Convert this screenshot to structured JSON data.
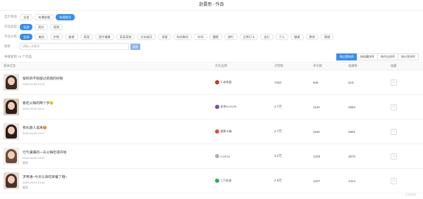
{
  "page_title": "赵露思 - 作品",
  "filters": {
    "row1": {
      "label": "显示筛选",
      "chips": [
        "全部",
        "有播放量",
        "有视频号"
      ],
      "active": 2
    },
    "row2": {
      "label": "作品类型",
      "chips": [
        "全部",
        "图文",
        "视频"
      ],
      "active": 0
    },
    "row3": {
      "label": "作品分类",
      "chips": [
        "全部",
        "美妆",
        "护肤",
        "美食",
        "萌宠",
        "医疗健康",
        "家居家装",
        "文化娱乐",
        "母婴",
        "科技数码",
        "时尚",
        "摄影",
        "旅行",
        "日常打卡",
        "出行",
        "个人",
        "健康",
        "教育",
        "情感"
      ],
      "active": 0
    },
    "row4": {
      "label": "搜索",
      "placeholder": "请输入关键词",
      "button": "搜索"
    }
  },
  "result_count": "共搜索到 74 个作品",
  "sort_buttons": [
    "按点赞排序",
    "按收藏排序",
    "按评论排序",
    "按分享排序"
  ],
  "sort_active": 0,
  "columns": [
    "基本信息",
    "合作品牌",
    "点赞数",
    "评论数",
    "收藏数",
    "收藏"
  ],
  "rows": [
    {
      "title": "留校的不陪留过的我的好啦",
      "date": "2020-10-09 10:21",
      "extra": "",
      "author": "小迪电器",
      "likes": "7250",
      "comments": "945",
      "collects": "619",
      "hair": "#3b2a24",
      "bg": "#e9e3de",
      "aicon": "#c0392b"
    },
    {
      "title": "看吃火锅的两个手🙂",
      "date": "2020-09-30 16:11",
      "extra": "",
      "author": "参考NYSCPL",
      "likes": "2.7万",
      "comments": "1134",
      "collects": "2693",
      "hair": "#2b1e19",
      "bg": "#d8c9b8",
      "aicon": "#7a4ea3"
    },
    {
      "title": "有伙题人选来😡",
      "date": "2020-09-25 19:07",
      "extra": "",
      "author": "健康卡编",
      "likes": "2.7万",
      "comments": "1165",
      "collects": "2861",
      "hair": "#2a1c17",
      "bg": "#eae4e2",
      "aicon": "#e74c3c"
    },
    {
      "title": "元气满满的一天火锅吃得开始",
      "date": "2020-09-08 18:37",
      "extra": "搬家",
      "author": "COSTA",
      "likes": "3.2万",
      "comments": "1229",
      "collects": "3570",
      "hair": "#6a4b3a",
      "bg": "#f2e9e6",
      "aicon": "#b0b0b0"
    },
    {
      "title": "求粤语~今天认真吃早餐了哦~",
      "date": "2020-09-03 19:44",
      "extra": "搬家",
      "author": "三只松鼠",
      "likes": "2.5万",
      "comments": "1227",
      "collects": "1314",
      "hair": "#4b3128",
      "bg": "#e6dbd2",
      "aicon": "#27ae60"
    }
  ],
  "star_symbol": "☆",
  "watermark": "CSWS"
}
